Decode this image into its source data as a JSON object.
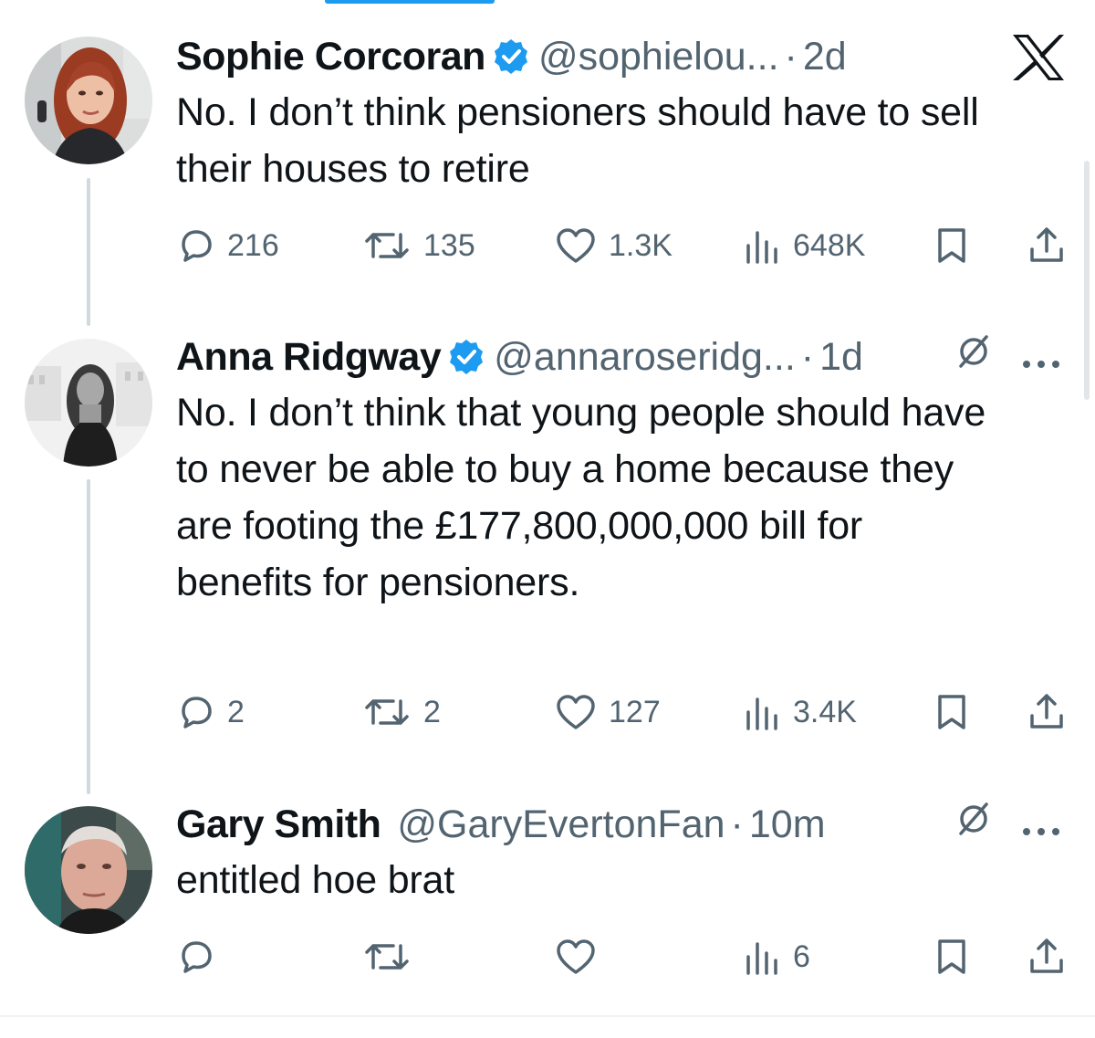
{
  "brand": {
    "logo_icon": "x-logo-icon",
    "accent_color": "#1d9bf0",
    "text_color": "#0f1419",
    "muted_color": "#536471"
  },
  "tweets": [
    {
      "name": "Sophie Corcoran",
      "verified": true,
      "handle": "@sophielou...",
      "separator": "·",
      "time": "2d",
      "text": "No. I don’t think pensioners should have to sell their houses to retire",
      "actions": {
        "replies": "216",
        "reposts": "135",
        "likes": "1.3K",
        "views": "648K"
      }
    },
    {
      "name": "Anna Ridgway",
      "verified": true,
      "handle": "@annaroseridg...",
      "separator": "·",
      "time": "1d",
      "text": "No. I don’t think that young people should have to never be able to buy a home because they are footing the £177,800,000,000 bill for benefits for pensioners.",
      "actions": {
        "replies": "2",
        "reposts": "2",
        "likes": "127",
        "views": "3.4K"
      }
    },
    {
      "name": "Gary Smith",
      "verified": false,
      "handle": "@GaryEvertonFan",
      "separator": "·",
      "time": "10m",
      "text": "entitled hoe brat",
      "actions": {
        "replies": "",
        "reposts": "",
        "likes": "",
        "views": "6"
      }
    }
  ]
}
